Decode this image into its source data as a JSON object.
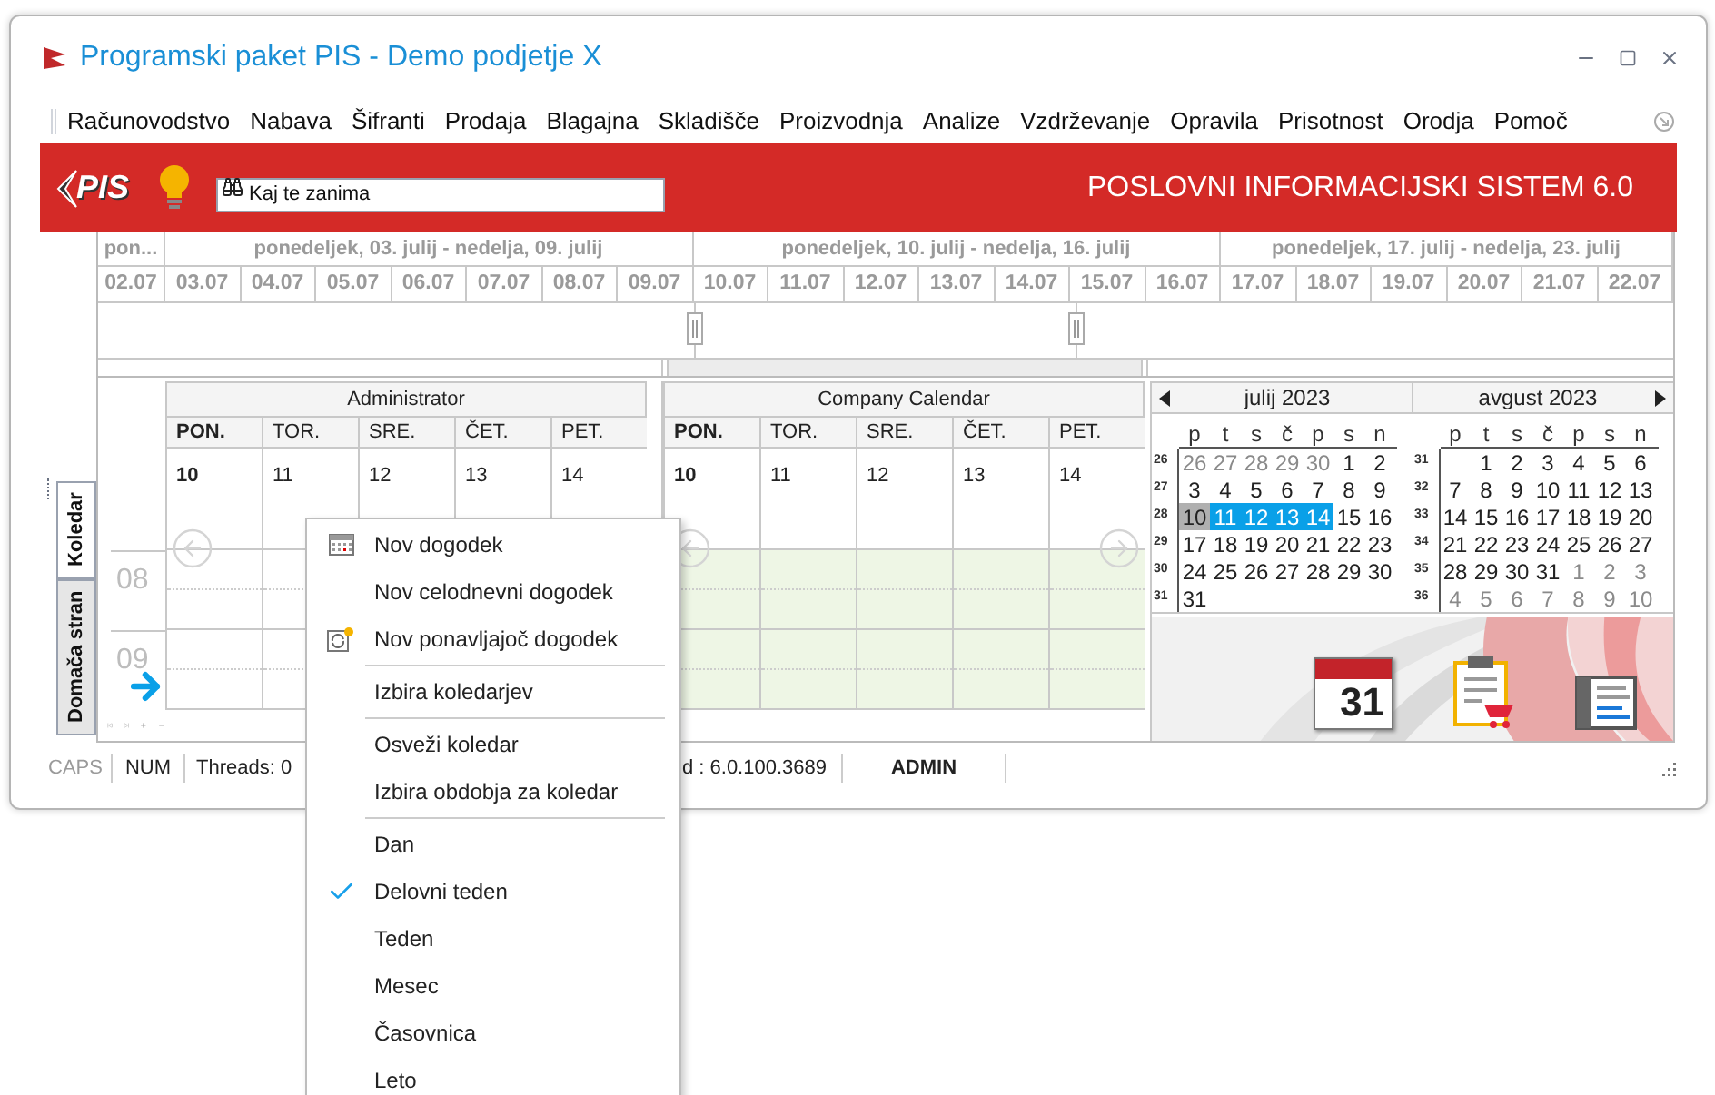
{
  "window": {
    "title": "Programski paket PIS - Demo podjetje X"
  },
  "menu": [
    "Računovodstvo",
    "Nabava",
    "Šifranti",
    "Prodaja",
    "Blagajna",
    "Skladišče",
    "Proizvodnja",
    "Analize",
    "Vzdrževanje",
    "Opravila",
    "Prisotnost",
    "Orodja",
    "Pomoč"
  ],
  "header": {
    "logo": "PIS",
    "search": {
      "placeholder": "Kaj te zanima"
    },
    "title": "POSLOVNI INFORMACIJSKI SISTEM 6.0"
  },
  "side_tabs": [
    {
      "label": "Koledar",
      "selected": true
    },
    {
      "label": "Domača stran",
      "selected": false
    }
  ],
  "timeline": {
    "weeks": [
      "pon...",
      "ponedeljek, 03. julij - nedelja, 09. julij",
      "ponedeljek, 10. julij - nedelja, 16. julij",
      "ponedeljek, 17. julij - nedelja, 23. julij"
    ],
    "dates": [
      "02.07",
      "03.07",
      "04.07",
      "05.07",
      "06.07",
      "07.07",
      "08.07",
      "09.07",
      "10.07",
      "11.07",
      "12.07",
      "13.07",
      "14.07",
      "15.07",
      "16.07",
      "17.07",
      "18.07",
      "19.07",
      "20.07",
      "21.07",
      "22.07"
    ]
  },
  "calendars": [
    {
      "name": "Administrator",
      "tinted": false,
      "days": [
        {
          "head": "PON.",
          "date": "10",
          "current": true
        },
        {
          "head": "TOR.",
          "date": "11",
          "current": false
        },
        {
          "head": "SRE.",
          "date": "12",
          "current": false
        },
        {
          "head": "ČET.",
          "date": "13",
          "current": false
        },
        {
          "head": "PET.",
          "date": "14",
          "current": false
        }
      ]
    },
    {
      "name": "Company Calendar",
      "tinted": true,
      "days": [
        {
          "head": "PON.",
          "date": "10",
          "current": true
        },
        {
          "head": "TOR.",
          "date": "11",
          "current": false
        },
        {
          "head": "SRE.",
          "date": "12",
          "current": false
        },
        {
          "head": "ČET.",
          "date": "13",
          "current": false
        },
        {
          "head": "PET.",
          "date": "14",
          "current": false
        }
      ]
    }
  ],
  "time_slots": [
    "08",
    "09"
  ],
  "mini_calendar": {
    "months": [
      {
        "name": "julij 2023",
        "weekdays": [
          "p",
          "t",
          "s",
          "č",
          "p",
          "s",
          "n"
        ],
        "weeks": [
          {
            "week": "26",
            "days": [
              {
                "day": "26",
                "kind": "other",
                "selected": false
              },
              {
                "day": "27",
                "kind": "other",
                "selected": false
              },
              {
                "day": "28",
                "kind": "other",
                "selected": false
              },
              {
                "day": "29",
                "kind": "other",
                "selected": false
              },
              {
                "day": "30",
                "kind": "other",
                "selected": false
              },
              {
                "day": "1",
                "kind": "normal",
                "selected": false
              },
              {
                "day": "2",
                "kind": "normal",
                "selected": false
              }
            ]
          },
          {
            "week": "27",
            "days": [
              {
                "day": "3",
                "kind": "normal",
                "selected": false
              },
              {
                "day": "4",
                "kind": "normal",
                "selected": false
              },
              {
                "day": "5",
                "kind": "normal",
                "selected": false
              },
              {
                "day": "6",
                "kind": "normal",
                "selected": false
              },
              {
                "day": "7",
                "kind": "normal",
                "selected": false
              },
              {
                "day": "8",
                "kind": "normal",
                "selected": false
              },
              {
                "day": "9",
                "kind": "normal",
                "selected": false
              }
            ]
          },
          {
            "week": "28",
            "days": [
              {
                "day": "10",
                "kind": "today",
                "selected": false
              },
              {
                "day": "11",
                "kind": "normal",
                "selected": true
              },
              {
                "day": "12",
                "kind": "normal",
                "selected": true
              },
              {
                "day": "13",
                "kind": "normal",
                "selected": true
              },
              {
                "day": "14",
                "kind": "normal",
                "selected": true
              },
              {
                "day": "15",
                "kind": "normal",
                "selected": false
              },
              {
                "day": "16",
                "kind": "normal",
                "selected": false
              }
            ]
          },
          {
            "week": "29",
            "days": [
              {
                "day": "17",
                "kind": "normal",
                "selected": false
              },
              {
                "day": "18",
                "kind": "normal",
                "selected": false
              },
              {
                "day": "19",
                "kind": "normal",
                "selected": false
              },
              {
                "day": "20",
                "kind": "normal",
                "selected": false
              },
              {
                "day": "21",
                "kind": "normal",
                "selected": false
              },
              {
                "day": "22",
                "kind": "normal",
                "selected": false
              },
              {
                "day": "23",
                "kind": "normal",
                "selected": false
              }
            ]
          },
          {
            "week": "30",
            "days": [
              {
                "day": "24",
                "kind": "normal",
                "selected": false
              },
              {
                "day": "25",
                "kind": "normal",
                "selected": false
              },
              {
                "day": "26",
                "kind": "normal",
                "selected": false
              },
              {
                "day": "27",
                "kind": "normal",
                "selected": false
              },
              {
                "day": "28",
                "kind": "normal",
                "selected": false
              },
              {
                "day": "29",
                "kind": "normal",
                "selected": false
              },
              {
                "day": "30",
                "kind": "normal",
                "selected": false
              }
            ]
          },
          {
            "week": "31",
            "days": [
              {
                "day": "31",
                "kind": "normal",
                "selected": false
              }
            ]
          }
        ]
      },
      {
        "name": "avgust 2023",
        "weekdays": [
          "p",
          "t",
          "s",
          "č",
          "p",
          "s",
          "n"
        ],
        "weeks": [
          {
            "week": "31",
            "days": [
              {
                "day": "1",
                "kind": "normal",
                "selected": false
              },
              {
                "day": "2",
                "kind": "normal",
                "selected": false
              },
              {
                "day": "3",
                "kind": "normal",
                "selected": false
              },
              {
                "day": "4",
                "kind": "normal",
                "selected": false
              },
              {
                "day": "5",
                "kind": "normal",
                "selected": false
              },
              {
                "day": "6",
                "kind": "normal",
                "selected": false
              }
            ]
          },
          {
            "week": "32",
            "days": [
              {
                "day": "7",
                "kind": "normal",
                "selected": false
              },
              {
                "day": "8",
                "kind": "normal",
                "selected": false
              },
              {
                "day": "9",
                "kind": "normal",
                "selected": false
              },
              {
                "day": "10",
                "kind": "normal",
                "selected": false
              },
              {
                "day": "11",
                "kind": "normal",
                "selected": false
              },
              {
                "day": "12",
                "kind": "normal",
                "selected": false
              },
              {
                "day": "13",
                "kind": "normal",
                "selected": false
              }
            ]
          },
          {
            "week": "33",
            "days": [
              {
                "day": "14",
                "kind": "normal",
                "selected": false
              },
              {
                "day": "15",
                "kind": "normal",
                "selected": false
              },
              {
                "day": "16",
                "kind": "normal",
                "selected": false
              },
              {
                "day": "17",
                "kind": "normal",
                "selected": false
              },
              {
                "day": "18",
                "kind": "normal",
                "selected": false
              },
              {
                "day": "19",
                "kind": "normal",
                "selected": false
              },
              {
                "day": "20",
                "kind": "normal",
                "selected": false
              }
            ]
          },
          {
            "week": "34",
            "days": [
              {
                "day": "21",
                "kind": "normal",
                "selected": false
              },
              {
                "day": "22",
                "kind": "normal",
                "selected": false
              },
              {
                "day": "23",
                "kind": "normal",
                "selected": false
              },
              {
                "day": "24",
                "kind": "normal",
                "selected": false
              },
              {
                "day": "25",
                "kind": "normal",
                "selected": false
              },
              {
                "day": "26",
                "kind": "normal",
                "selected": false
              },
              {
                "day": "27",
                "kind": "normal",
                "selected": false
              }
            ]
          },
          {
            "week": "35",
            "days": [
              {
                "day": "28",
                "kind": "normal",
                "selected": false
              },
              {
                "day": "29",
                "kind": "normal",
                "selected": false
              },
              {
                "day": "30",
                "kind": "normal",
                "selected": false
              },
              {
                "day": "31",
                "kind": "normal",
                "selected": false
              },
              {
                "day": "1",
                "kind": "other",
                "selected": false
              },
              {
                "day": "2",
                "kind": "other",
                "selected": false
              },
              {
                "day": "3",
                "kind": "other",
                "selected": false
              }
            ]
          },
          {
            "week": "36",
            "days": [
              {
                "day": "4",
                "kind": "other",
                "selected": false
              },
              {
                "day": "5",
                "kind": "other",
                "selected": false
              },
              {
                "day": "6",
                "kind": "other",
                "selected": false
              },
              {
                "day": "7",
                "kind": "other",
                "selected": false
              },
              {
                "day": "8",
                "kind": "other",
                "selected": false
              },
              {
                "day": "9",
                "kind": "other",
                "selected": false
              },
              {
                "day": "10",
                "kind": "other",
                "selected": false
              }
            ]
          }
        ]
      }
    ]
  },
  "shortcuts": [
    {
      "kind": "calendar",
      "label": "31"
    },
    {
      "kind": "order"
    },
    {
      "kind": "list"
    }
  ],
  "status_bar": [
    {
      "text": "CAPS",
      "kind": "key",
      "active": false
    },
    {
      "text": "NUM",
      "kind": "key",
      "active": true
    },
    {
      "text": "Threads: 0",
      "kind": "info",
      "active": true
    },
    {
      "text": "d : 6.0.100.3689",
      "kind": "version",
      "active": true
    },
    {
      "text": "ADMIN",
      "kind": "user",
      "active": true
    }
  ],
  "context_menu": [
    {
      "kind": "event",
      "label": "Nov dogodek",
      "checked": false
    },
    {
      "kind": "plain",
      "label": "Nov celodnevni dogodek",
      "checked": false
    },
    {
      "kind": "recurring",
      "label": "Nov ponavljajoč dogodek",
      "checked": false
    },
    {
      "kind": "separator"
    },
    {
      "kind": "plain",
      "label": "Izbira koledarjev",
      "checked": false
    },
    {
      "kind": "separator"
    },
    {
      "kind": "plain",
      "label": "Osveži koledar",
      "checked": false
    },
    {
      "kind": "plain",
      "label": "Izbira obdobja za koledar",
      "checked": false
    },
    {
      "kind": "separator"
    },
    {
      "kind": "plain",
      "label": "Dan",
      "checked": false
    },
    {
      "kind": "plain",
      "label": "Delovni teden",
      "checked": true
    },
    {
      "kind": "plain",
      "label": "Teden",
      "checked": false
    },
    {
      "kind": "plain",
      "label": "Mesec",
      "checked": false
    },
    {
      "kind": "plain",
      "label": "Časovnica",
      "checked": false
    },
    {
      "kind": "plain",
      "label": "Leto",
      "checked": false
    }
  ]
}
